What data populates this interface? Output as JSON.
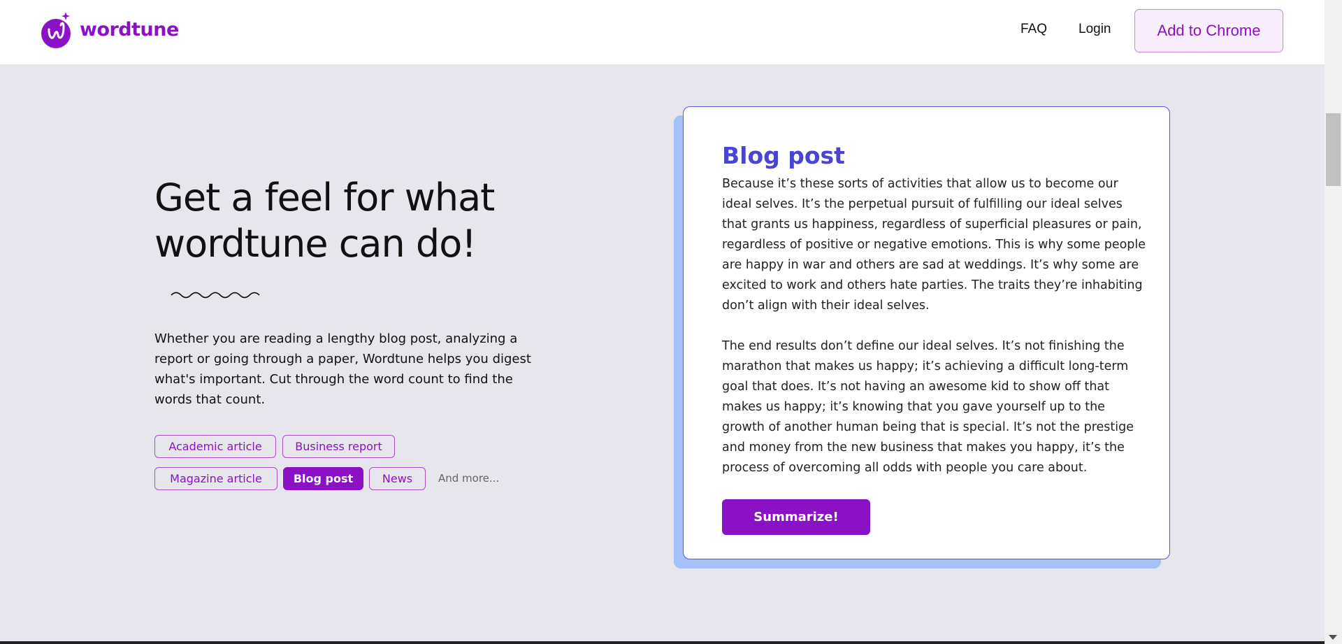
{
  "header": {
    "logo_text": "wordtune",
    "nav": {
      "faq": "FAQ",
      "login": "Login"
    },
    "cta": "Add to Chrome"
  },
  "hero": {
    "headline_line1": "Get a feel for what",
    "headline_line2": "wordtune can do!",
    "intro": "Whether you are reading a lengthy blog post, analyzing a report or going through a paper, Wordtune helps you digest what's important. Cut through the word count to find the words that count."
  },
  "chips": {
    "academic": "Academic article",
    "business": "Business report",
    "magazine": "Magazine article",
    "blog": "Blog post",
    "news": "News",
    "more": "And more..."
  },
  "card": {
    "title": "Blog post",
    "paragraph1": "Because it’s these sorts of activities that allow us to become our ideal selves. It’s the perpetual pursuit of fulfilling our ideal selves that grants us happiness, regardless of superficial pleasures or pain, regardless of positive or negative emotions. This is why some people are happy in war and others are sad at weddings. It’s why some are excited to work and others hate parties. The traits they’re inhabiting don’t align with their ideal selves.",
    "paragraph2": "The end results don’t define our ideal selves. It’s not finishing the marathon that makes us happy; it’s achieving a difficult long-term goal that does. It’s not having an awesome kid to show off that makes us happy; it’s knowing that you gave yourself up to the growth of another human being that is special. It’s not the prestige and money from the new business that makes you happy, it’s the process of overcoming all odds with people you care about.",
    "button": "Summarize!"
  },
  "colors": {
    "brand_purple": "#8a12c4",
    "card_title_blue": "#4a43d4",
    "card_border": "#5b54e3",
    "card_shadow": "#a4c1f9",
    "page_bg": "#e6e6ec"
  },
  "icons": {
    "logo": "wordtune-logo-icon",
    "squiggle": "squiggle-divider-icon"
  }
}
